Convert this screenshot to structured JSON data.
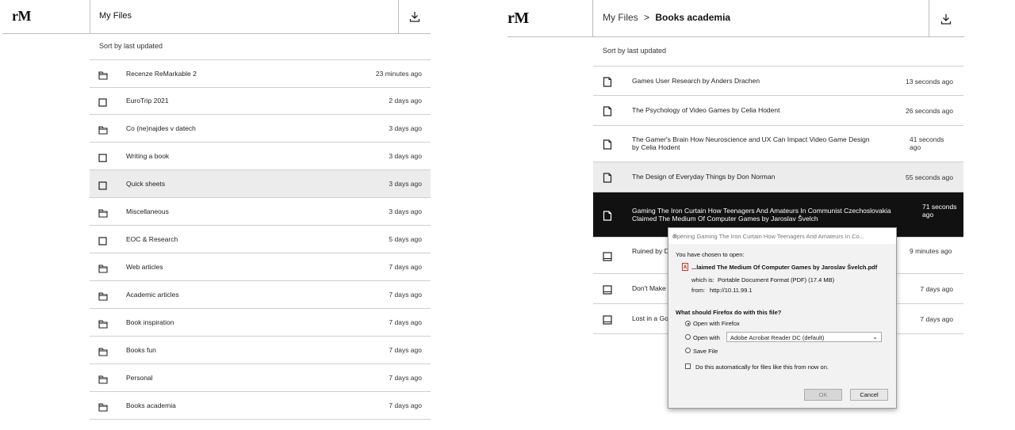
{
  "left": {
    "logo": "rM",
    "title": "My Files",
    "sort_label": "Sort by last updated",
    "items": [
      {
        "type": "folder",
        "name": "Recenze ReMarkable 2",
        "time": "23 minutes ago"
      },
      {
        "type": "notebook",
        "name": "EuroTrip 2021",
        "time": "2 days ago"
      },
      {
        "type": "folder",
        "name": "Co (ne)najdes v datech",
        "time": "3 days ago"
      },
      {
        "type": "notebook",
        "name": "Writing a book",
        "time": "3 days ago"
      },
      {
        "type": "notebook",
        "name": "Quick sheets",
        "time": "3 days ago"
      },
      {
        "type": "folder",
        "name": "Miscellaneous",
        "time": "3 days ago"
      },
      {
        "type": "notebook",
        "name": "EOC & Research",
        "time": "5 days ago"
      },
      {
        "type": "folder",
        "name": "Web articles",
        "time": "7 days ago"
      },
      {
        "type": "folder",
        "name": "Academic articles",
        "time": "7 days ago"
      },
      {
        "type": "folder",
        "name": "Book inspiration",
        "time": "7 days ago"
      },
      {
        "type": "folder",
        "name": "Books fun",
        "time": "7 days ago"
      },
      {
        "type": "folder",
        "name": "Personal",
        "time": "7 days ago"
      },
      {
        "type": "folder",
        "name": "Books academia",
        "time": "7 days ago"
      }
    ]
  },
  "right": {
    "logo": "rM",
    "breadcrumb_root": "My Files",
    "breadcrumb_sep": ">",
    "breadcrumb_current": "Books academia",
    "sort_label": "Sort by last updated",
    "items": [
      {
        "type": "doc",
        "name": "Games User Research by Anders Drachen",
        "time": "13 seconds ago"
      },
      {
        "type": "doc",
        "name": "The Psychology of Video Games by Celia Hodent",
        "time": "26 seconds ago"
      },
      {
        "type": "doc",
        "name": "The Gamer's Brain How Neuroscience and UX Can Impact Video Game Design by Celia Hodent",
        "time": "41 seconds ago"
      },
      {
        "type": "doc",
        "name": "The Design of Everyday Things by Don Norman",
        "time": "55 seconds ago"
      },
      {
        "type": "doc",
        "name": "Gaming The Iron Curtain How Teenagers And Amateurs In Communist Czechoslovakia Claimed The Medium Of Computer Games by Jaroslav Švelch",
        "time": "71 seconds ago"
      },
      {
        "type": "book",
        "name": "Ruined by Design: How Designers Destroyed the World and What We Can Do to Fix It",
        "time": "9 minutes ago"
      },
      {
        "type": "book",
        "name": "Don't Make Me Think",
        "time": "7 days ago"
      },
      {
        "type": "book",
        "name": "Lost in a Good Game",
        "time": "7 days ago"
      }
    ]
  },
  "dialog": {
    "title": "Opening Gaming The Iron Curtain How Teenagers And Amateurs In Co...",
    "close": "✕",
    "chosen": "You have chosen to open:",
    "filename": "...laimed The Medium Of Computer Games by Jaroslav Švelch.pdf",
    "which_is_label": "which is:",
    "which_is": "Portable Document Format (PDF) (17.4 MB)",
    "from_label": "from:",
    "from": "http://10.11.99.1",
    "question": "What should Firefox do with this file?",
    "opt_firefox": "Open with Firefox",
    "opt_open_with": "Open with",
    "open_with_app": "Adobe Acrobat Reader DC (default)",
    "opt_save": "Save File",
    "auto": "Do this automatically for files like this from now on.",
    "ok": "OK",
    "cancel": "Cancel"
  }
}
